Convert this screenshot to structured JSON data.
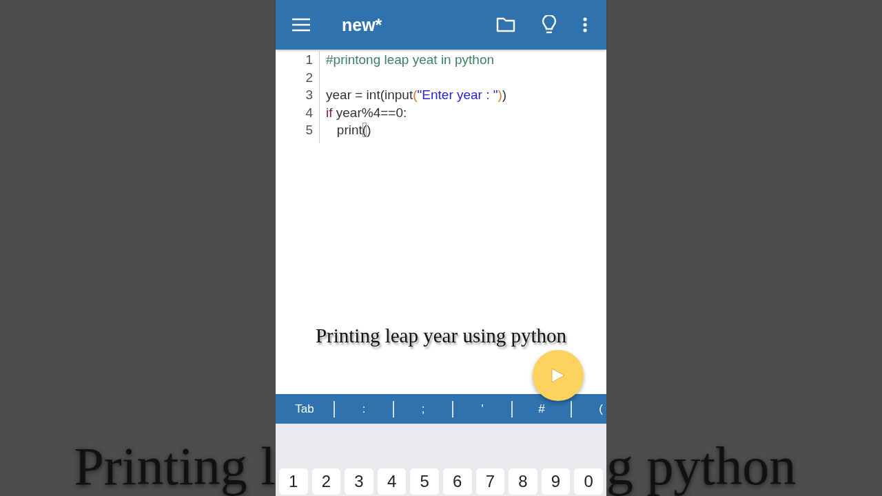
{
  "backdrop": {
    "left_text": "Printing l",
    "right_text": "g python"
  },
  "app_bar": {
    "title": "new*"
  },
  "editor": {
    "lines": [
      {
        "number": "1",
        "tokens": [
          {
            "kind": "comment",
            "text": "#printong leap yeat in python"
          }
        ]
      },
      {
        "number": "2"
      },
      {
        "number": "3",
        "tokens": [
          {
            "kind": "plain",
            "text": "year = int(input"
          },
          {
            "kind": "bracket",
            "text": "("
          },
          {
            "kind": "string",
            "text": "\"Enter year : \""
          },
          {
            "kind": "bracket",
            "text": ")"
          },
          {
            "kind": "plain",
            "text": ")"
          }
        ]
      },
      {
        "number": "4",
        "tokens": [
          {
            "kind": "keyword",
            "text": "if"
          },
          {
            "kind": "plain",
            "text": " year%4==0:"
          }
        ]
      },
      {
        "number": "5",
        "tokens": [
          {
            "kind": "plain",
            "text": "   print"
          },
          {
            "kind": "matched",
            "text": "("
          },
          {
            "kind": "plain",
            "text": ")"
          }
        ]
      }
    ]
  },
  "caption": "Printing leap year using python",
  "symbol_bar": [
    "Tab",
    ":",
    ";",
    "'",
    "#",
    "("
  ],
  "keyboard": {
    "keys": [
      "1",
      "2",
      "3",
      "4",
      "5",
      "6",
      "7",
      "8",
      "9",
      "0"
    ]
  }
}
